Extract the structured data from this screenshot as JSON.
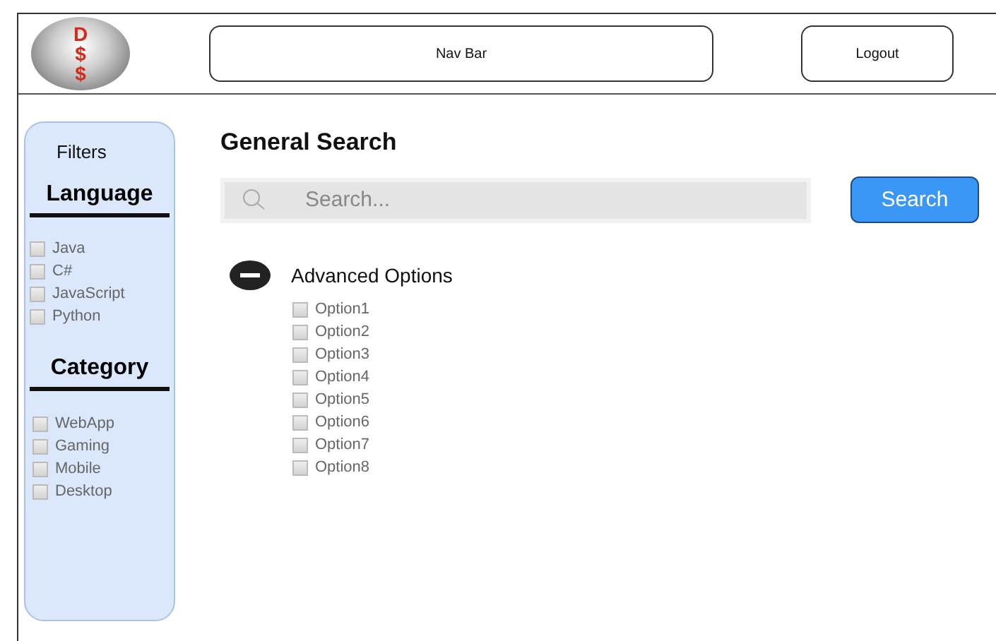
{
  "header": {
    "logo_text": "D$$",
    "nav_bar": "Nav Bar",
    "logout": "Logout"
  },
  "filters": {
    "title": "Filters",
    "groups": [
      {
        "title": "Language",
        "items": [
          {
            "label": "Java",
            "checked": false
          },
          {
            "label": "C#",
            "checked": false
          },
          {
            "label": "JavaScript",
            "checked": false
          },
          {
            "label": "Python",
            "checked": false
          }
        ]
      },
      {
        "title": "Category",
        "items": [
          {
            "label": "WebApp",
            "checked": false
          },
          {
            "label": "Gaming",
            "checked": false
          },
          {
            "label": "Mobile",
            "checked": false
          },
          {
            "label": "Desktop",
            "checked": false
          }
        ]
      }
    ]
  },
  "search": {
    "title": "General Search",
    "placeholder": "Search...",
    "button": "Search"
  },
  "advanced": {
    "label": "Advanced Options",
    "expanded": true,
    "options": [
      {
        "label": "Option1",
        "checked": false
      },
      {
        "label": "Option2",
        "checked": false
      },
      {
        "label": "Option3",
        "checked": false
      },
      {
        "label": "Option4",
        "checked": false
      },
      {
        "label": "Option5",
        "checked": false
      },
      {
        "label": "Option6",
        "checked": false
      },
      {
        "label": "Option7",
        "checked": false
      },
      {
        "label": "Option8",
        "checked": false
      }
    ]
  }
}
